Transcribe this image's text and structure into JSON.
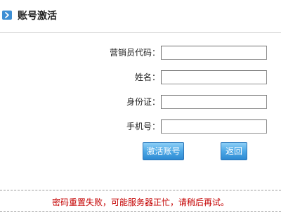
{
  "header": {
    "icon": "chevron-right-icon",
    "title": "账号激活",
    "accent_color": "#3e8fd4"
  },
  "form": {
    "fields": [
      {
        "label": "营销员代码：",
        "value": "",
        "placeholder": ""
      },
      {
        "label": "姓名：",
        "value": "",
        "placeholder": ""
      },
      {
        "label": "身份证：",
        "value": "",
        "placeholder": ""
      },
      {
        "label": "手机号：",
        "value": "",
        "placeholder": ""
      }
    ]
  },
  "buttons": {
    "activate_label": "激活账号",
    "back_label": "返回",
    "color": "#4da8e6"
  },
  "message": {
    "text": "密码重置失败，可能服务器正忙，请稍后再试。",
    "color": "#c40000"
  }
}
